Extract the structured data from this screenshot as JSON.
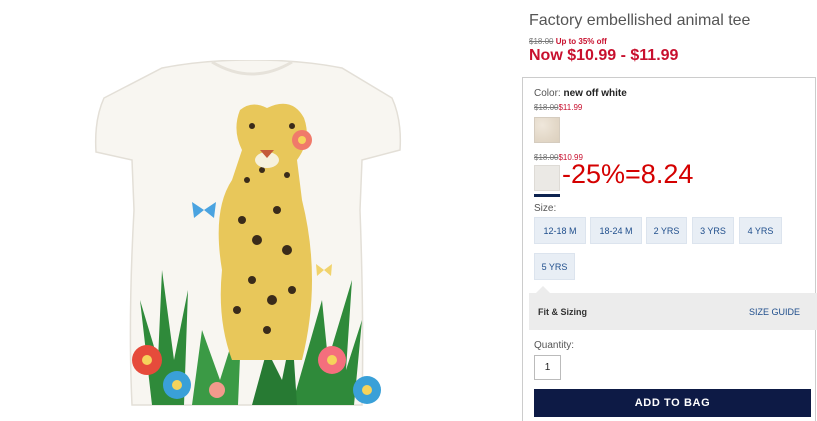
{
  "product": {
    "title": "Factory embellished animal tee",
    "promo_original": "$18.00",
    "promo_discount": "Up to 35% off",
    "now_price": "Now $10.99 - $11.99",
    "image": "white-tee-leopard-graphic"
  },
  "color": {
    "label": "Color:",
    "selected": "new off white",
    "swatches": [
      {
        "original": "$18.00",
        "sale": "$11.99",
        "color": "#e6ddd0"
      },
      {
        "original": "$18.00",
        "sale": "$10.99",
        "color": "#ebe9e5",
        "selected": true
      }
    ]
  },
  "annotation": "-25%=8.24",
  "size": {
    "label": "Size:",
    "options": [
      "12-18 M",
      "18-24 M",
      "2 YRS",
      "3 YRS",
      "4 YRS",
      "5 YRS"
    ]
  },
  "fit": {
    "label": "Fit & Sizing",
    "guide": "SIZE GUIDE"
  },
  "quantity": {
    "label": "Quantity:",
    "value": "1"
  },
  "cart": {
    "add_label": "ADD TO BAG"
  },
  "colors": {
    "sale": "#c8102e",
    "navy": "#0d1a45",
    "link": "#1f4e8c"
  }
}
